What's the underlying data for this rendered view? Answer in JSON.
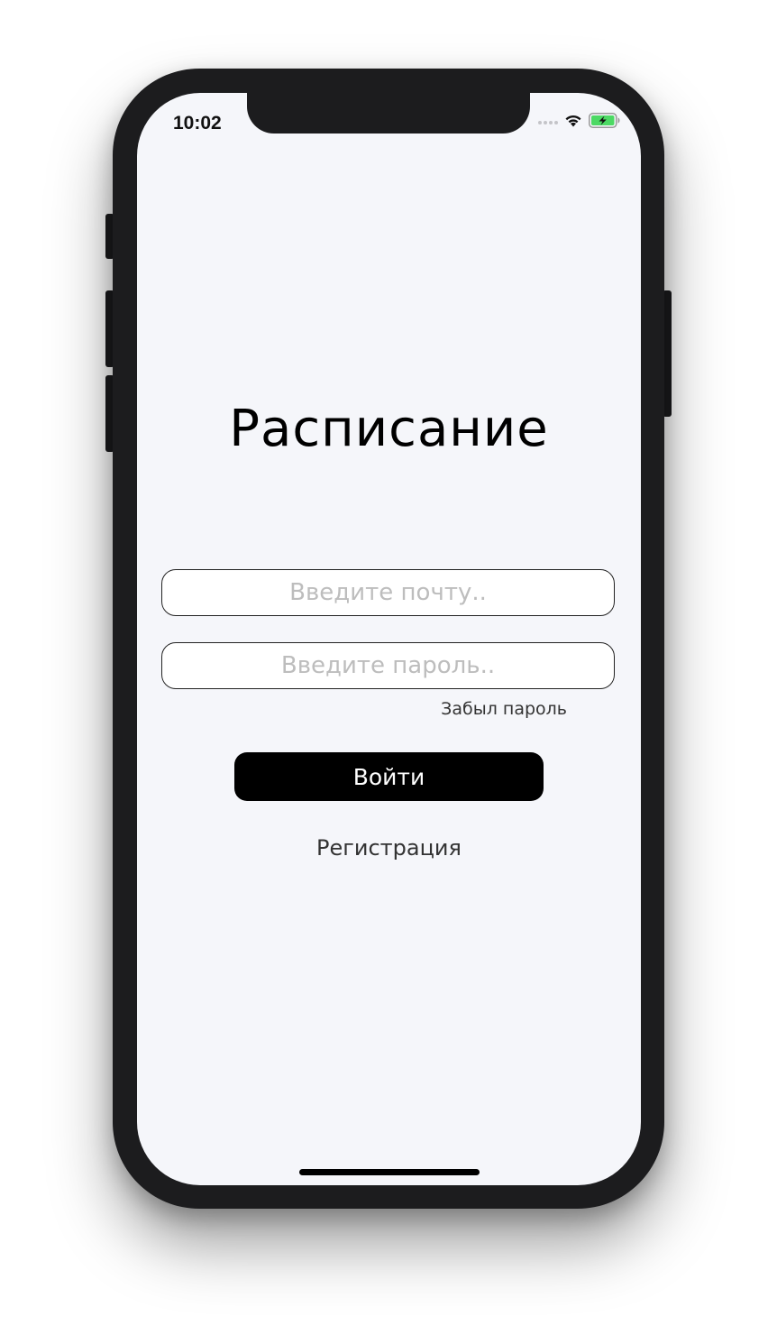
{
  "status_bar": {
    "time": "10:02",
    "signal_icon": "signal-dots-icon",
    "wifi_icon": "wifi-icon",
    "battery_icon": "battery-charging-icon",
    "battery_color": "#4cd964"
  },
  "app": {
    "title": "Расписание"
  },
  "form": {
    "email_placeholder": "Введите почту..",
    "email_value": "",
    "password_placeholder": "Введите пароль..",
    "password_value": "",
    "forgot_label": "Забыл пароль",
    "login_label": "Войти",
    "register_label": "Регистрация"
  },
  "colors": {
    "screen_background": "#f5f6fa",
    "button_background": "#000000",
    "button_text": "#ffffff",
    "placeholder_text": "#bdbdbd",
    "phone_frame": "#1c1c1e"
  }
}
